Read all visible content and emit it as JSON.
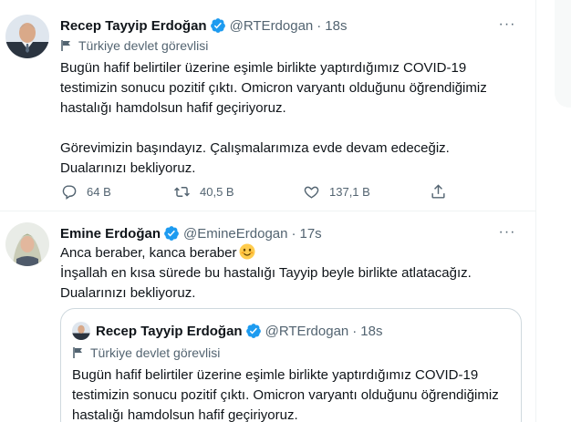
{
  "tweets": [
    {
      "author": "Recep Tayyip Erdoğan",
      "handle": "@RTErdogan",
      "separator": "·",
      "time": "18s",
      "label": "Türkiye devlet görevlisi",
      "paragraphs": [
        "Bugün hafif belirtiler üzerine eşimle birlikte yaptırdığımız COVID-19 testimizin sonucu pozitif çıktı. Omicron varyantı olduğunu öğrendiğimiz hastalığı hamdolsun hafif geçiriyoruz.",
        "Görevimizin başındayız. Çalışmalarımıza evde devam edeceğiz. Dualarınızı bekliyoruz."
      ],
      "actions": {
        "reply_count": "64 B",
        "retweet_count": "40,5 B",
        "like_count": "137,1 B"
      }
    },
    {
      "author": "Emine Erdoğan",
      "handle": "@EmineErdogan",
      "separator": "·",
      "time": "17s",
      "lines": [
        "Anca beraber, kanca beraber",
        "İnşallah en kısa sürede bu hastalığı Tayyip beyle birlikte atlatacağız.",
        "Dualarınızı bekliyoruz."
      ],
      "emoji": "smiling-face-icon",
      "quote": {
        "author": "Recep Tayyip Erdoğan",
        "handle": "@RTErdogan",
        "separator": "·",
        "time": "18s",
        "label": "Türkiye devlet görevlisi",
        "text": "Bugün hafif belirtiler üzerine eşimle birlikte yaptırdığımız COVID-19 testimizin sonucu pozitif çıktı. Omicron varyantı olduğunu öğrendiğimiz hastalığı hamdolsun hafif geçiriyoruz."
      }
    }
  ],
  "more_label": "···",
  "colors": {
    "verified": "#1d9bf0",
    "secondary_text": "#536471",
    "border": "#cfd9de"
  }
}
